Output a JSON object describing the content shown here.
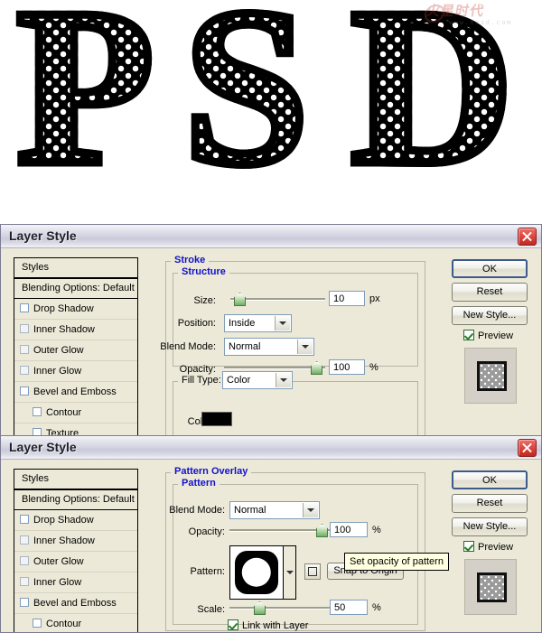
{
  "artwork": {
    "letters": [
      "P",
      "S",
      "D"
    ],
    "watermark": {
      "main": "火星时代",
      "sub": "www.hxsd.com"
    }
  },
  "dialog_stroke": {
    "title": "Layer Style",
    "close_label": "×",
    "styles_pane": {
      "header": "Styles",
      "blending_options": "Blending Options: Default",
      "items": [
        {
          "label": "Drop Shadow"
        },
        {
          "label": "Inner Shadow"
        },
        {
          "label": "Outer Glow"
        },
        {
          "label": "Inner Glow"
        },
        {
          "label": "Bevel and Emboss"
        },
        {
          "label": "Contour"
        },
        {
          "label": "Texture"
        }
      ]
    },
    "group_title": "Stroke",
    "sub_title": "Structure",
    "fields": {
      "size_label": "Size:",
      "size_value": "10",
      "size_unit": "px",
      "position_label": "Position:",
      "position_value": "Inside",
      "blend_mode_label": "Blend Mode:",
      "blend_mode_value": "Normal",
      "opacity_label": "Opacity:",
      "opacity_value": "100",
      "opacity_unit": "%",
      "fill_type_label": "Fill Type:",
      "fill_type_value": "Color",
      "color_label": "Color:",
      "color_value": "#000000"
    },
    "buttons": {
      "ok": "OK",
      "reset": "Reset",
      "new_style": "New Style...",
      "preview": "Preview"
    }
  },
  "dialog_pattern": {
    "title": "Layer Style",
    "close_label": "×",
    "styles_pane": {
      "header": "Styles",
      "blending_options": "Blending Options: Default",
      "items": [
        {
          "label": "Drop Shadow"
        },
        {
          "label": "Inner Shadow"
        },
        {
          "label": "Outer Glow"
        },
        {
          "label": "Inner Glow"
        },
        {
          "label": "Bevel and Emboss"
        },
        {
          "label": "Contour"
        }
      ]
    },
    "group_title": "Pattern Overlay",
    "sub_title": "Pattern",
    "fields": {
      "blend_mode_label": "Blend Mode:",
      "blend_mode_value": "Normal",
      "opacity_label": "Opacity:",
      "opacity_value": "100",
      "opacity_unit": "%",
      "pattern_label": "Pattern:",
      "snap_to_origin": "Snap to Origin",
      "scale_label": "Scale:",
      "scale_value": "50",
      "scale_unit": "%",
      "link_with_layer": "Link with Layer"
    },
    "tooltip": "Set opacity of pattern",
    "buttons": {
      "ok": "OK",
      "reset": "Reset",
      "new_style": "New Style...",
      "preview": "Preview"
    }
  }
}
